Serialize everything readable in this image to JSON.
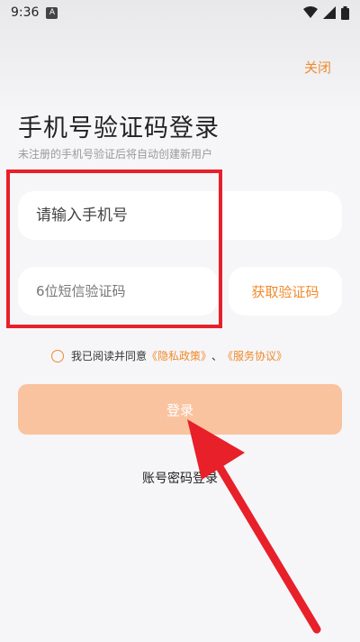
{
  "status_bar": {
    "time": "9:36",
    "notification_badge": "A",
    "icons": [
      "wifi-icon",
      "signal-icon",
      "battery-icon"
    ]
  },
  "header": {
    "close_label": "关闭"
  },
  "main": {
    "title": "手机号验证码登录",
    "subtitle": "未注册的手机号验证后将自动创建新用户"
  },
  "form": {
    "phone_placeholder": "请输入手机号",
    "code_placeholder": "6位短信验证码",
    "get_code_label": "获取验证码"
  },
  "agreement": {
    "prefix": "我已阅读并同意",
    "privacy_link": "《隐私政策》",
    "separator": "、",
    "service_link": "《服务协议》"
  },
  "actions": {
    "login_label": "登录",
    "password_login_label": "账号密码登录"
  },
  "colors": {
    "accent": "#f08a2c",
    "login_button_bg": "#f9c3a0",
    "annotation": "#e8202a"
  }
}
